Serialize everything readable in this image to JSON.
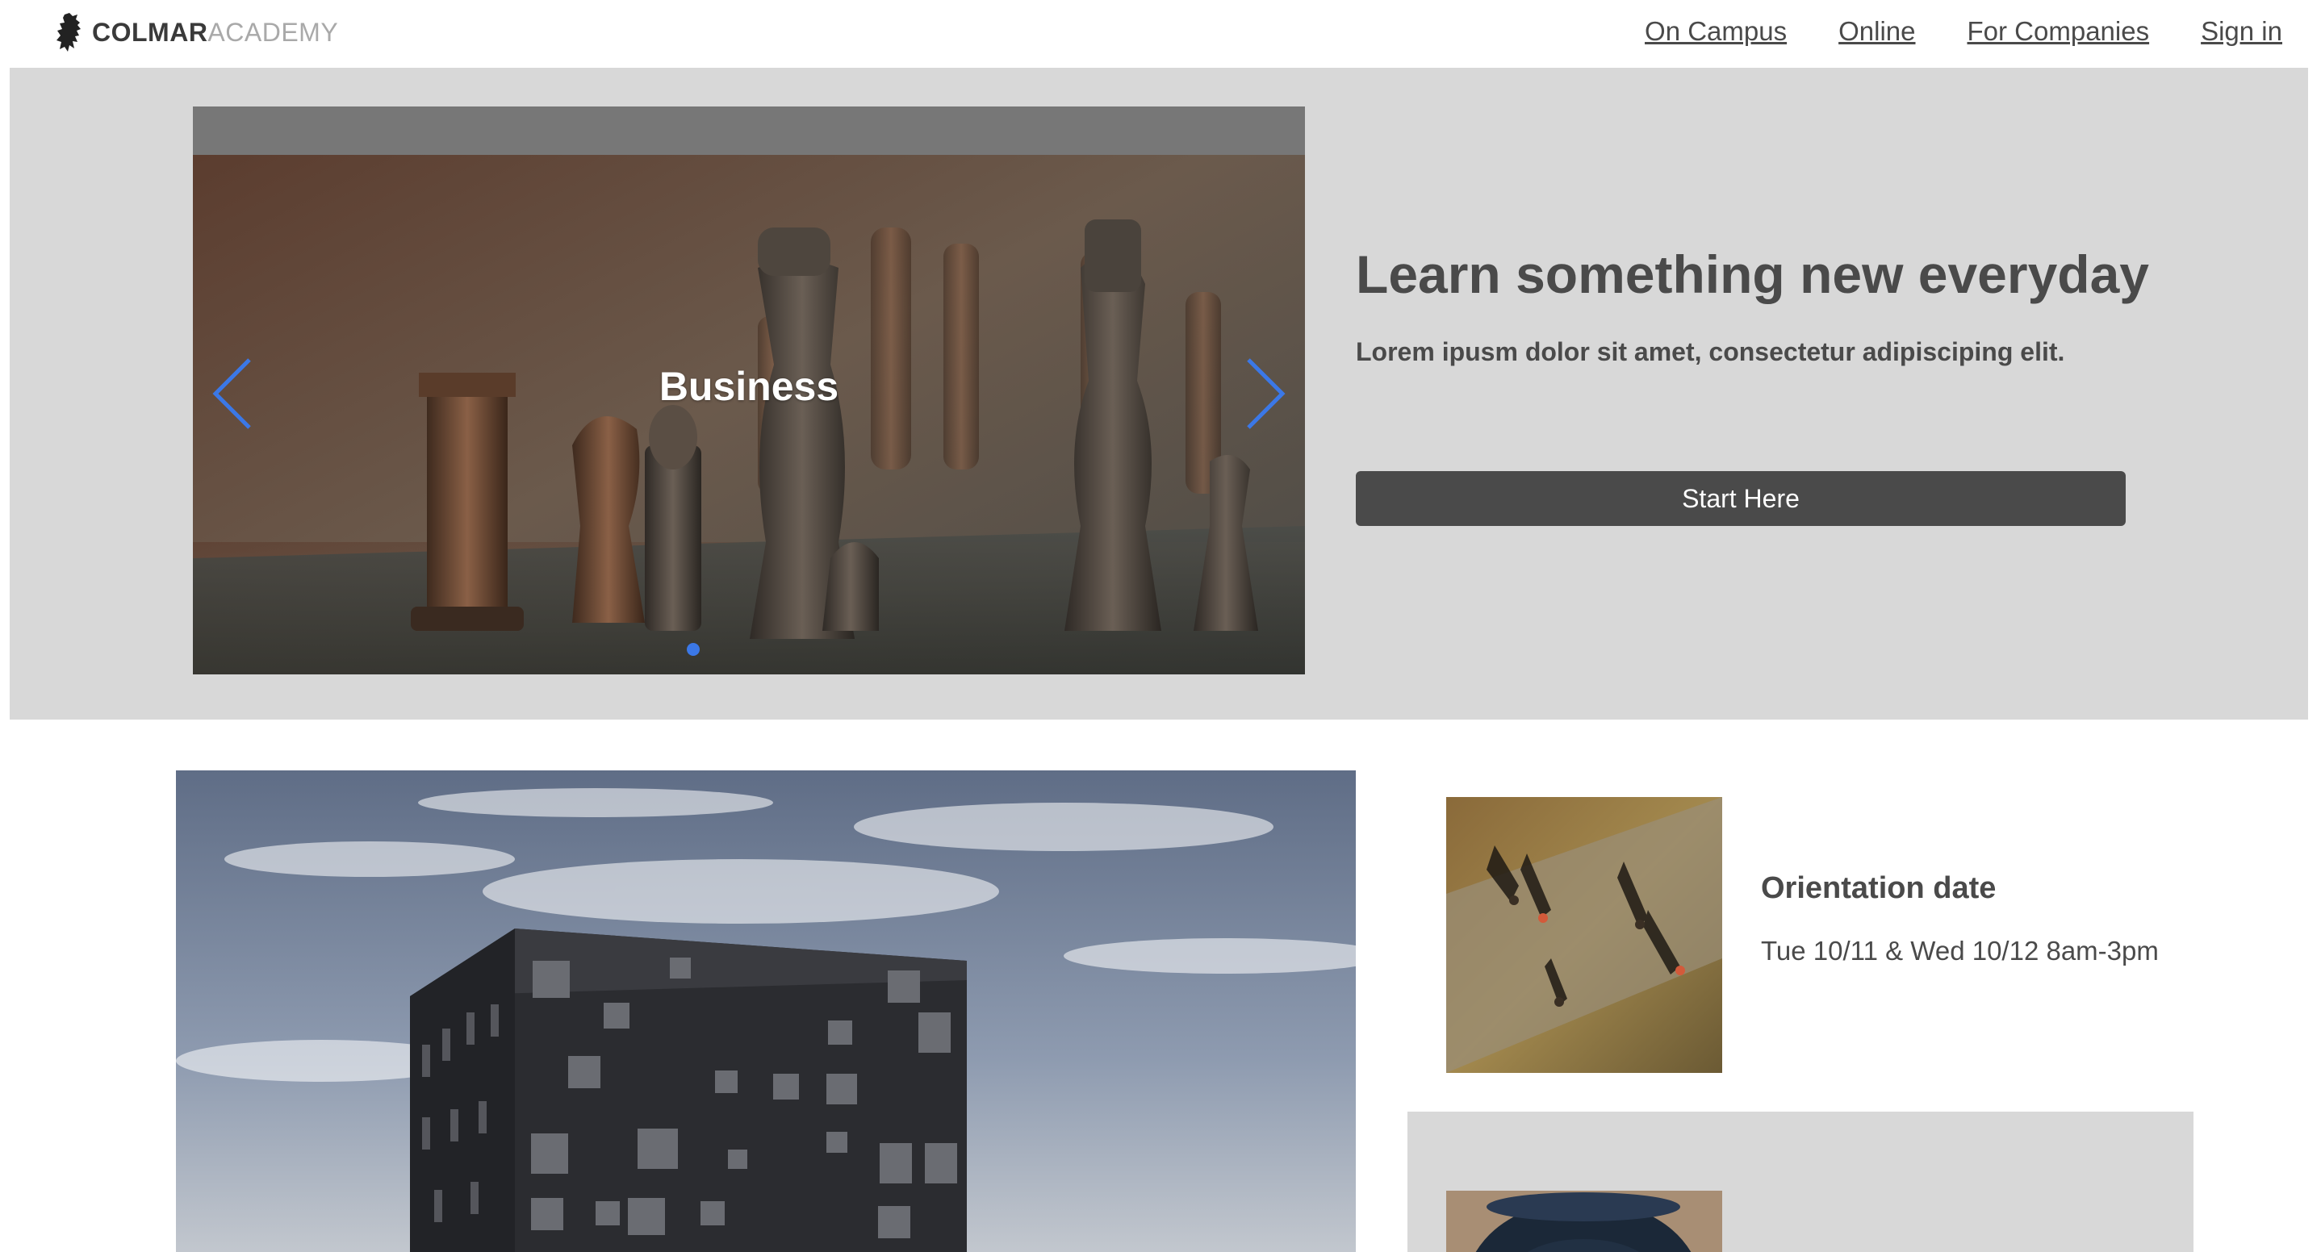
{
  "brand": {
    "name_bold": "COLMAR",
    "name_light": "ACADEMY",
    "logo_icon": "lion-rampant-icon"
  },
  "nav": {
    "links": [
      {
        "label": "On Campus"
      },
      {
        "label": "Online"
      },
      {
        "label": "For Companies"
      },
      {
        "label": "Sign in"
      }
    ]
  },
  "hero": {
    "carousel": {
      "slide_caption": "Business",
      "prev_icon": "chevron-left-icon",
      "next_icon": "chevron-right-icon",
      "active_dot_index": 0,
      "dot_count": 1
    },
    "title": "Learn something new everyday",
    "subtitle": "Lorem ipusm dolor sit amet, consectetur adipisciping elit.",
    "cta_label": "Start Here"
  },
  "events": [
    {
      "title": "Orientation date",
      "date": "Tue 10/11 & Wed 10/12 8am-3pm"
    }
  ],
  "colors": {
    "accent": "#3b78e7",
    "hero_bg": "#d8d8d8",
    "button_bg": "#4a4a4a",
    "text": "#4a4a4a"
  }
}
